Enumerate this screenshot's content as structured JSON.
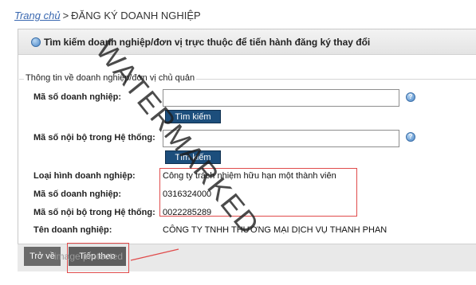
{
  "breadcrumb": {
    "home": "Trang chủ",
    "separator": ">",
    "current": "ĐĂNG KÝ DOANH NGHIỆP"
  },
  "panel": {
    "title": "Tìm kiếm doanh nghiệp/đơn vị trực thuộc để tiến hành đăng ký thay đổi"
  },
  "group": {
    "label": "Thông tin về doanh nghiệp/đơn vị chủ quản"
  },
  "search": {
    "enterprise_code_label": "Mã số doanh nghiệp:",
    "enterprise_code_value": "",
    "internal_code_label": "Mã số nội bộ trong Hệ thống:",
    "internal_code_value": "",
    "search_button": "Tìm kiếm"
  },
  "result": {
    "type_label": "Loại hình doanh nghiệp:",
    "type_value": "Công ty trách nhiệm hữu hạn một thành viên",
    "code_label": "Mã số doanh nghiệp:",
    "code_value": "0316324000",
    "internal_label": "Mã số nội bộ trong Hệ thống:",
    "internal_value": "0022285289",
    "name_label": "Tên doanh nghiệp:",
    "name_value": "CÔNG TY TNHH THƯƠNG MẠI DỊCH VỤ THANH PHAN"
  },
  "footer": {
    "back_button": "Trở về",
    "next_button": "Tiếp theo",
    "overlay_text": "image protected"
  },
  "watermark": "WATERMARKED",
  "icons": {
    "help": "question-help-icon"
  },
  "colors": {
    "accent": "#1c4e7c",
    "highlight": "#e04b4b",
    "link": "#3a68b0"
  }
}
